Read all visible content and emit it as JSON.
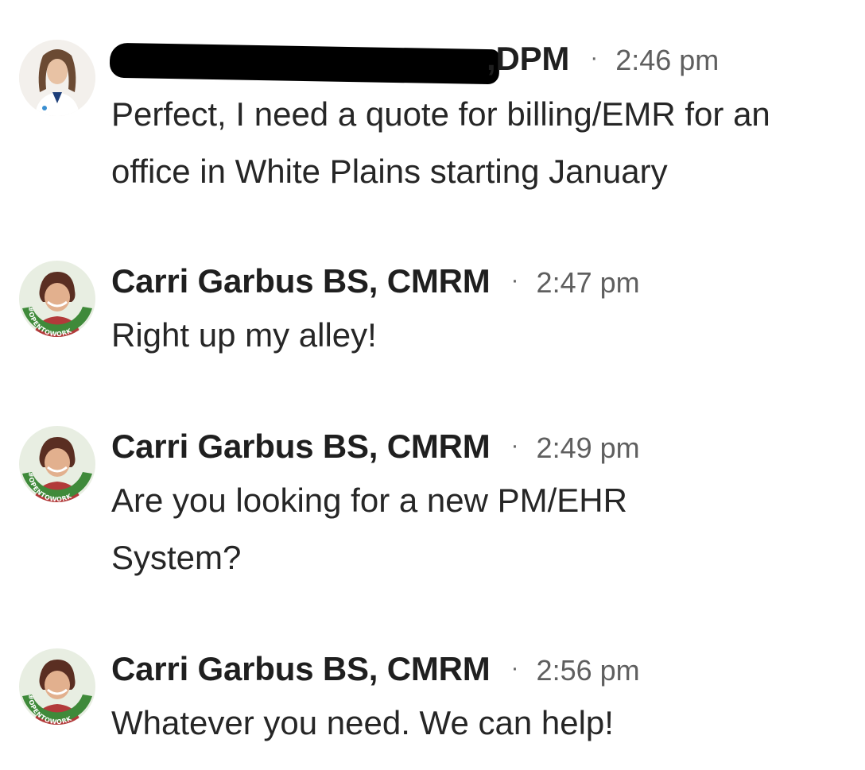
{
  "messages": [
    {
      "sender": "DPM",
      "sender_prefix": ",",
      "time": "2:46 pm",
      "text": "Perfect, I need a quote for billing/EMR for an office in White Plains starting January",
      "avatar_icon": "person-avatar"
    },
    {
      "sender": "Carri Garbus BS, CMRM",
      "time": "2:47 pm",
      "text": "Right up my alley!",
      "avatar_icon": "opentowork-avatar",
      "badge": "#OPENTOWORK"
    },
    {
      "sender": "Carri Garbus BS, CMRM",
      "time": "2:49 pm",
      "text": "Are you looking for a new PM/EHR System?",
      "avatar_icon": "opentowork-avatar",
      "badge": "#OPENTOWORK"
    },
    {
      "sender": "Carri Garbus BS, CMRM",
      "time": "2:56 pm",
      "text": "Whatever you need. We can help!",
      "avatar_icon": "opentowork-avatar",
      "badge": "#OPENTOWORK"
    }
  ],
  "separator": "·",
  "colors": {
    "opentowork_green": "#3f8a3a",
    "text": "#262626",
    "time": "#5f5f5f"
  }
}
